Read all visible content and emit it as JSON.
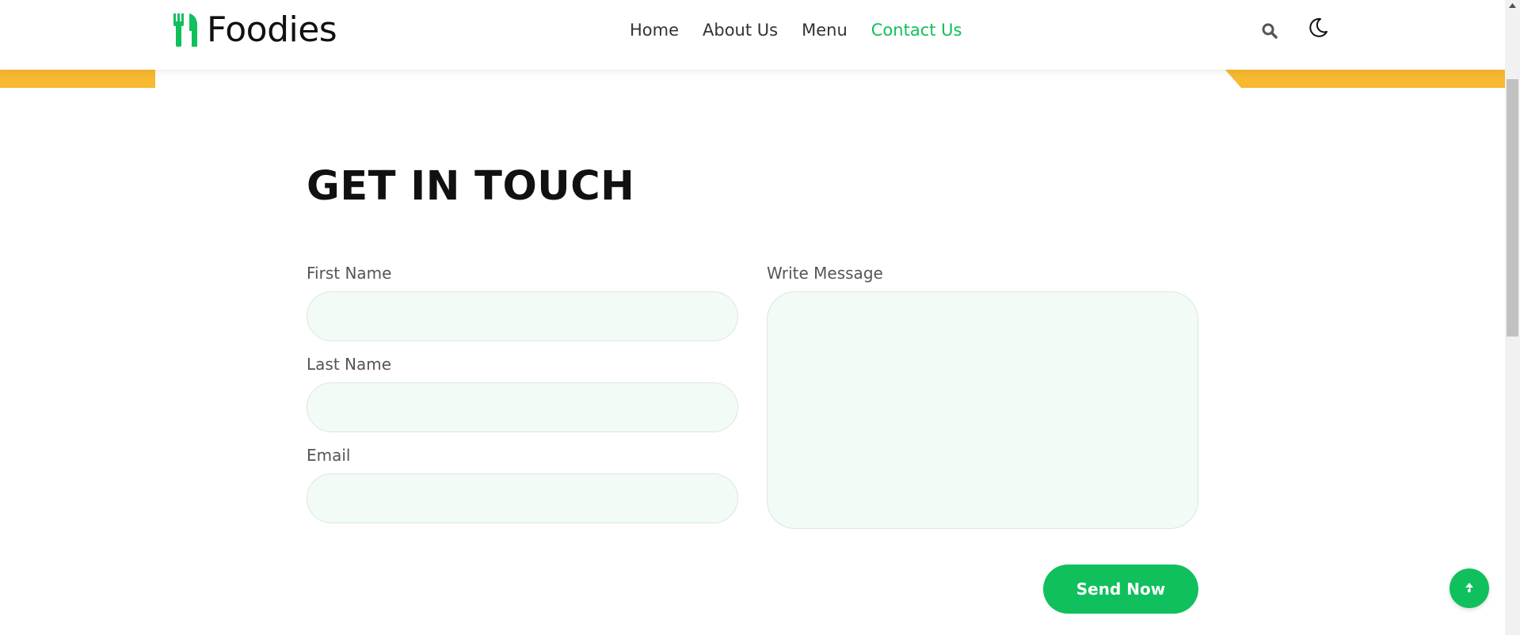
{
  "brand": {
    "name": "Foodies"
  },
  "nav": {
    "items": [
      {
        "label": "Home"
      },
      {
        "label": "About Us"
      },
      {
        "label": "Menu"
      },
      {
        "label": "Contact Us"
      }
    ],
    "active": "Contact Us"
  },
  "header": {
    "search_icon": "search-icon",
    "theme_icon": "moon-icon"
  },
  "contact": {
    "title": "GET IN TOUCH",
    "first_name_label": "First Name",
    "first_name_value": "",
    "last_name_label": "Last Name",
    "last_name_value": "",
    "email_label": "Email",
    "email_value": "",
    "message_label": "Write Message",
    "message_value": "",
    "send_label": "Send Now"
  },
  "scroll_to_top": {
    "icon": "arrow-up-icon"
  },
  "colors": {
    "accent": "#10c05c",
    "band": "#f8b931",
    "field_bg": "#f3fbf6",
    "text": "#111111"
  }
}
